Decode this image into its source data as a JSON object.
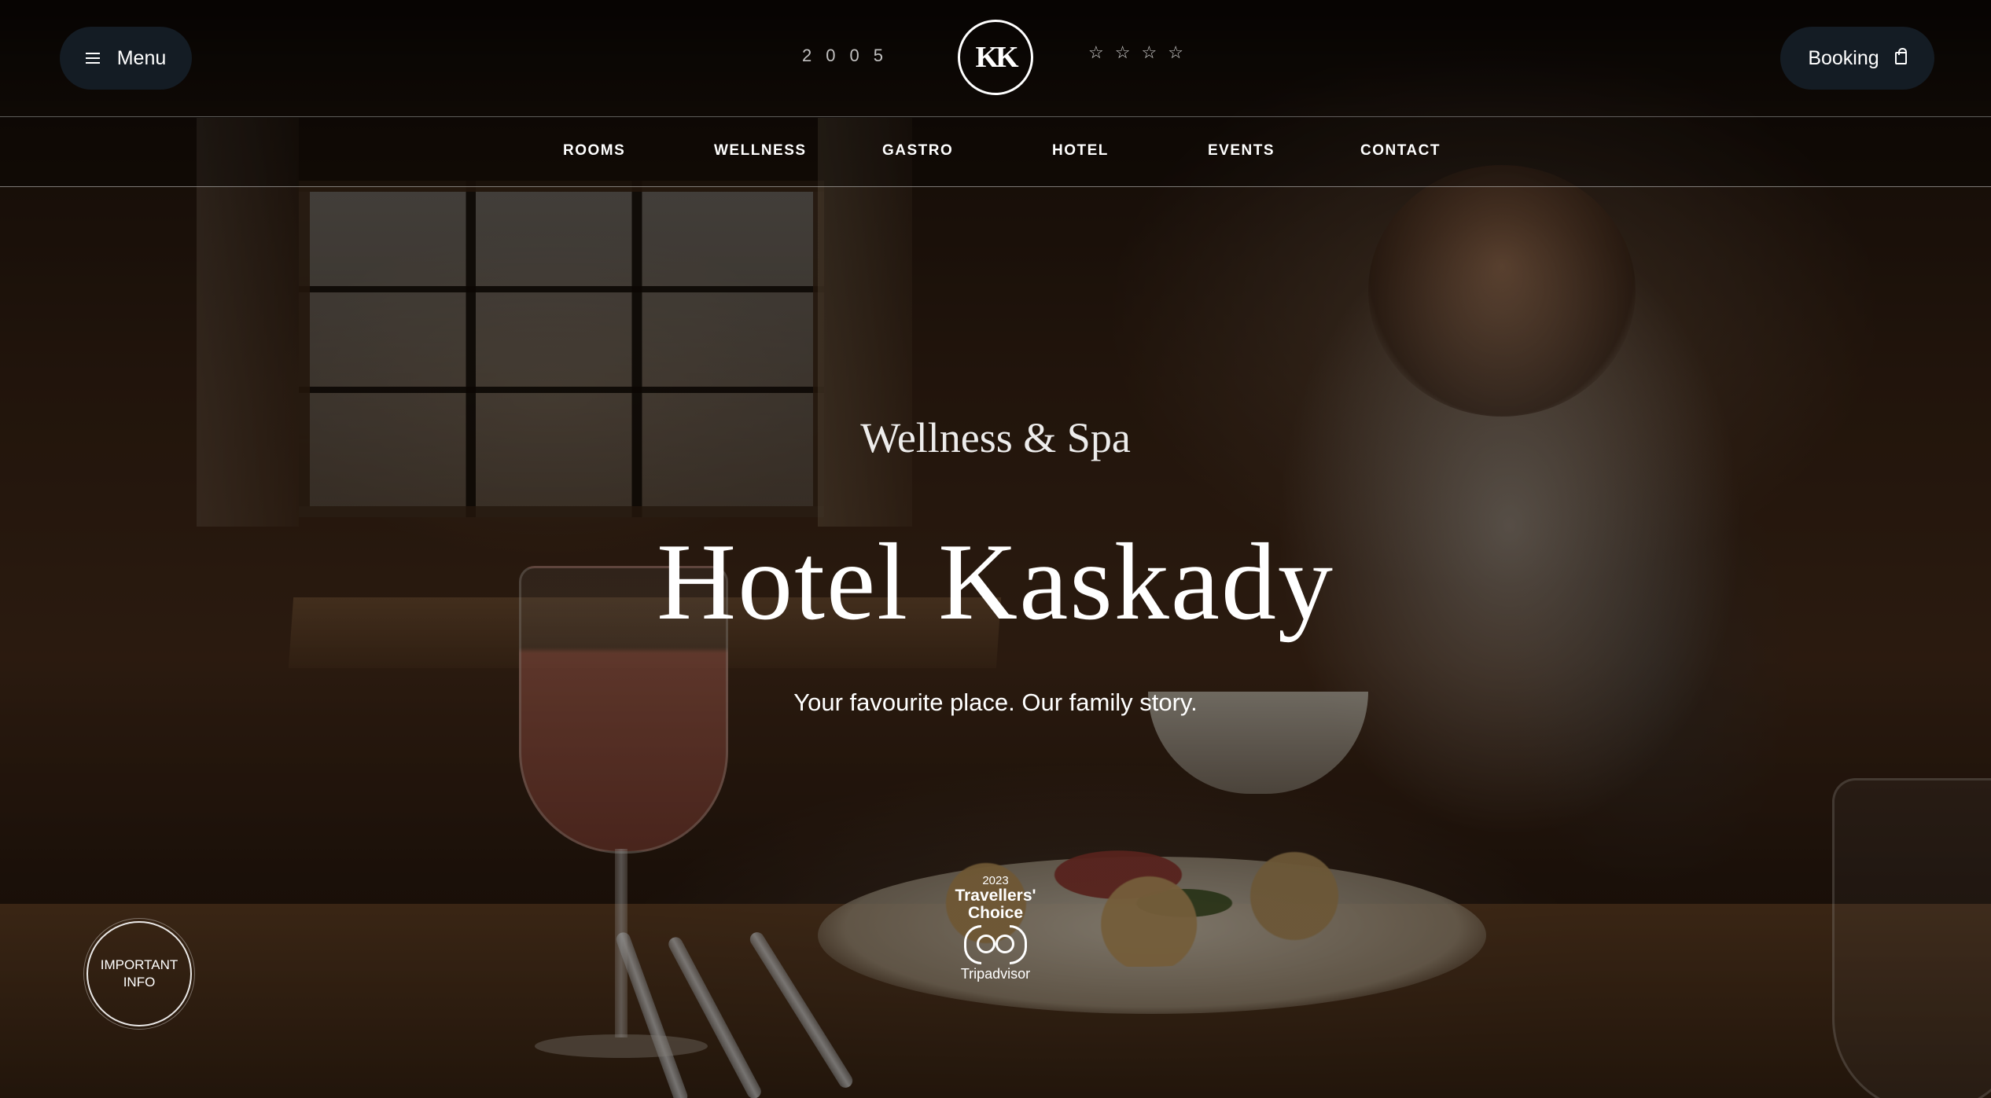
{
  "header": {
    "menu_label": "Menu",
    "year": "2005",
    "logo_text": "KK",
    "stars": [
      "☆",
      "☆",
      "☆",
      "☆"
    ],
    "booking_label": "Booking"
  },
  "nav": {
    "items": [
      "ROOMS",
      "WELLNESS",
      "GASTRO",
      "HOTEL",
      "EVENTS",
      "CONTACT"
    ]
  },
  "hero": {
    "subtitle": "Wellness & Spa",
    "title": "Hotel Kaskady",
    "tagline": "Your favourite place. Our family story."
  },
  "info_badge": {
    "line1": "IMPORTANT",
    "line2": "INFO"
  },
  "tripadvisor_badge": {
    "year": "2023",
    "line1": "Travellers'",
    "line2": "Choice",
    "brand": "Tripadvisor"
  },
  "colors": {
    "button_bg": "#141c24",
    "text": "#ffffff"
  }
}
